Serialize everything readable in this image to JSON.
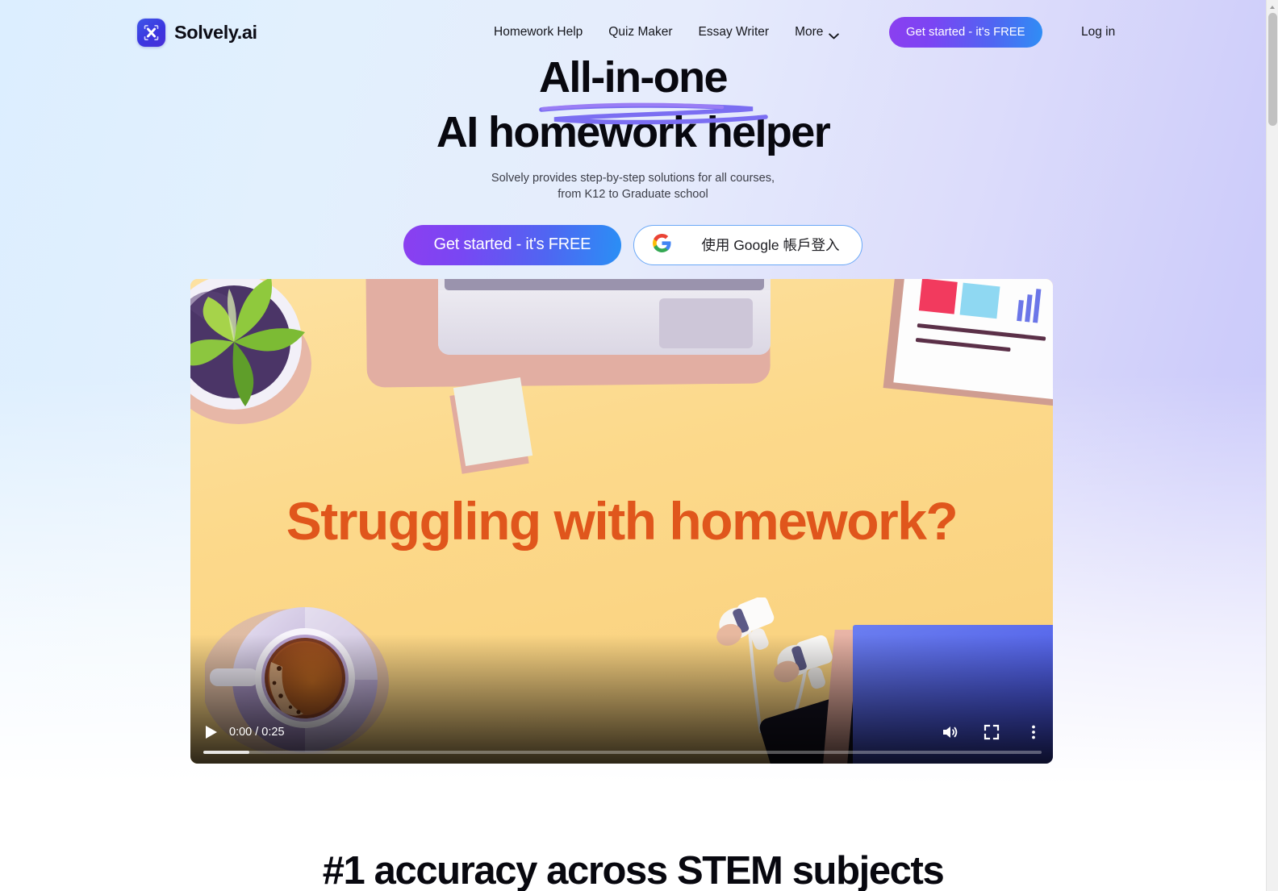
{
  "brand": {
    "name": "Solvely.ai",
    "logo_icon": "scan-x-logo-icon",
    "logo_color": "#3b36e0"
  },
  "header": {
    "nav_items": [
      {
        "label": "Homework Help"
      },
      {
        "label": "Quiz Maker"
      },
      {
        "label": "Essay Writer"
      }
    ],
    "more_label": "More",
    "more_icon": "chevron-down-icon",
    "cta_label": "Get started - it's FREE",
    "cta_gradient_from": "#8b3ff0",
    "cta_gradient_to": "#2f8ef5",
    "login_label": "Log in"
  },
  "hero": {
    "headline_line1": "All-in-one",
    "headline_line2": "AI homework helper",
    "underline_color": "#6b63f0",
    "subtitle_line1": "Solvely provides step-by-step solutions for all courses,",
    "subtitle_line2": "from K12 to Graduate school",
    "cta_primary_label": "Get started - it's FREE",
    "google_button_label": "使用 Google 帳戶登入",
    "google_icon": "google-g-icon"
  },
  "video": {
    "overlay_text": "Struggling with homework?",
    "overlay_text_color": "#e0561c",
    "background_color": "#fcd98b",
    "current_time": "0:00",
    "duration": "0:25",
    "time_display": "0:00 / 0:25",
    "progress_percent": 0,
    "loaded_percent": 5.5,
    "controls": {
      "play_icon": "play-icon",
      "volume_icon": "volume-on-icon",
      "fullscreen_icon": "fullscreen-icon",
      "more_options_icon": "kebab-menu-icon"
    },
    "scene_items": [
      {
        "name": "potted-plant"
      },
      {
        "name": "laptop"
      },
      {
        "name": "sticky-note"
      },
      {
        "name": "report-document"
      },
      {
        "name": "coffee-cup"
      },
      {
        "name": "earbuds"
      },
      {
        "name": "phone"
      },
      {
        "name": "book"
      }
    ]
  },
  "section": {
    "heading": "#1 accuracy across STEM subjects"
  },
  "scrollbar": {
    "up_arrow_icon": "scroll-up-arrow-icon"
  }
}
